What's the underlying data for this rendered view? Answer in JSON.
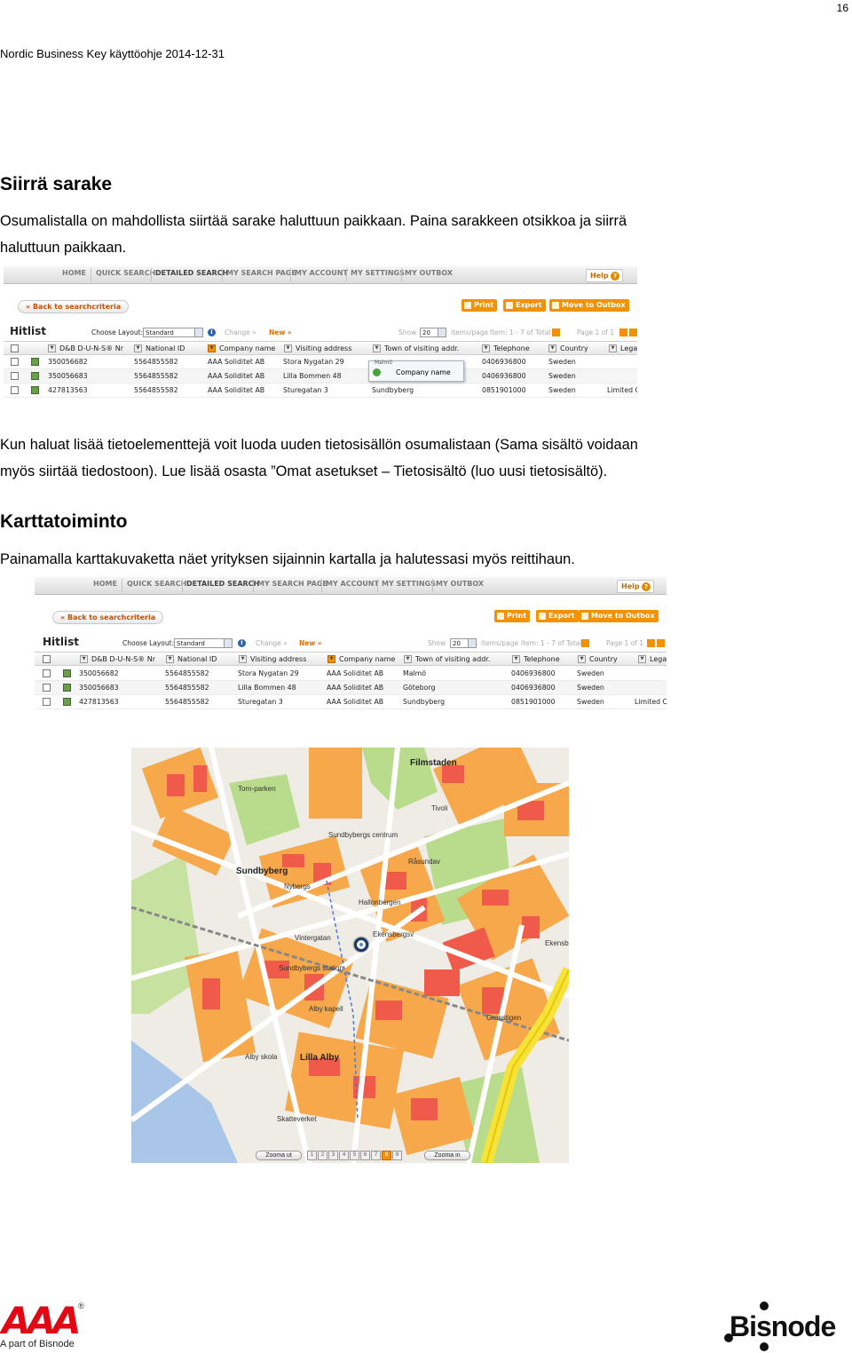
{
  "page": {
    "number": "16",
    "header": "Nordic Business Key käyttöohje 2014-12-31"
  },
  "section1": {
    "heading": "Siirrä sarake",
    "line1": "Osumalistalla on mahdollista siirtää sarake haluttuun paikkaan. Paina sarakkeen otsikkoa ja siirrä",
    "line2": "haluttuun paikkaan."
  },
  "app": {
    "nav_tabs": [
      "HOME",
      "QUICK SEARCH",
      "DETAILED SEARCH",
      "MY SEARCH PAGE",
      "MY ACCOUNT",
      "MY SETTINGS",
      "MY OUTBOX"
    ],
    "help": "Help",
    "back": "« Back to searchcriteria",
    "print": "Print",
    "export": "Export",
    "move_to_outbox": "Move to Outbox",
    "hitlist": "Hitlist",
    "choose_layout": "Choose Layout:",
    "layout_value": "Standard",
    "change": "Change »",
    "new": "New »",
    "show": "Show",
    "show_value": "20",
    "items_per_page": "items/page",
    "item_range": "Item: 1 - 7 of Total 7",
    "page_range": "Page 1 of 1"
  },
  "table1": {
    "columns": [
      "D&B D-U-N-S® Nr",
      "National ID",
      "Company name",
      "Visiting address",
      "Town of visiting addr.",
      "Telephone",
      "Country",
      "Lega"
    ],
    "rows": [
      [
        "350056682",
        "5564855582",
        "AAA Soliditet AB",
        "Stora Nygatan 29",
        "",
        "0406936800",
        "Sweden",
        ""
      ],
      [
        "350056683",
        "5564855582",
        "AAA Soliditet AB",
        "Lilla Bommen 48",
        "",
        "0406936800",
        "Sweden",
        ""
      ],
      [
        "427813563",
        "5564855582",
        "AAA Soliditet AB",
        "Sturegatan 3",
        "Sundbyberg",
        "0851901000",
        "Sweden",
        "Limited C"
      ]
    ],
    "drag_popup_label": "Company name",
    "drag_hidden_label": "Malmö"
  },
  "section1b": {
    "line1": "Kun haluat lisää tietoelementtejä voit luoda uuden tietosisällön osumalistaan (Sama sisältö voidaan",
    "line2": "myös siirtää tiedostoon). Lue lisää osasta ”Omat asetukset – Tietosisältö (luo uusi tietosisältö)."
  },
  "section2": {
    "heading": "Karttatoiminto",
    "line1": "Painamalla karttakuvaketta näet yrityksen sijainnin kartalla ja halutessasi myös reittihaun."
  },
  "table2": {
    "columns": [
      "D&B D-U-N-S® Nr",
      "National ID",
      "Visiting address",
      "Company name",
      "Town of visiting addr.",
      "Telephone",
      "Country",
      "Lega"
    ],
    "rows": [
      [
        "350056682",
        "5564855582",
        "Stora Nygatan 29",
        "AAA Soliditet AB",
        "Malmö",
        "0406936800",
        "Sweden",
        ""
      ],
      [
        "350056683",
        "5564855582",
        "Lilla Bommen 48",
        "AAA Soliditet AB",
        "Göteborg",
        "0406936800",
        "Sweden",
        ""
      ],
      [
        "427813563",
        "5564855582",
        "Sturegatan 3",
        "AAA Soliditet AB",
        "Sundbyberg",
        "0851901000",
        "Sweden",
        "Limited C"
      ]
    ]
  },
  "map": {
    "labels": {
      "filmstaden": "Filmstaden",
      "sundbyberg": "Sundbyberg",
      "lilla_alby": "Lilla Alby",
      "sundbybergs_centrum": "Sundbybergs centrum",
      "sundbybergs_station": "Sundbybergs station",
      "alby_kapell": "Alby kapell",
      "alby_skola": "Alby skola",
      "tornparken": "Torn-parken",
      "ekensberg": "Ekensb",
      "skattverket": "Skatteverket",
      "nybergs": "Nybergs",
      "hallonbergen": "Hallonbergen",
      "rasundav": "Råsundav",
      "skogen": "Tivoli",
      "grang": "Granstigen",
      "ekensbergsv": "Ekensbergsv",
      "vintergatan": "Vintergatan"
    },
    "zoom_out": "Zooma ut",
    "zoom_in": "Zooma in",
    "zoom_levels": [
      "1",
      "2",
      "3",
      "4",
      "5",
      "6",
      "7",
      "8",
      "9"
    ],
    "active_zoom": "8"
  },
  "footer": {
    "aaa_letters": "AAA",
    "aaa_sub": "A part of Bisnode",
    "bisnode": "Bisnode"
  }
}
